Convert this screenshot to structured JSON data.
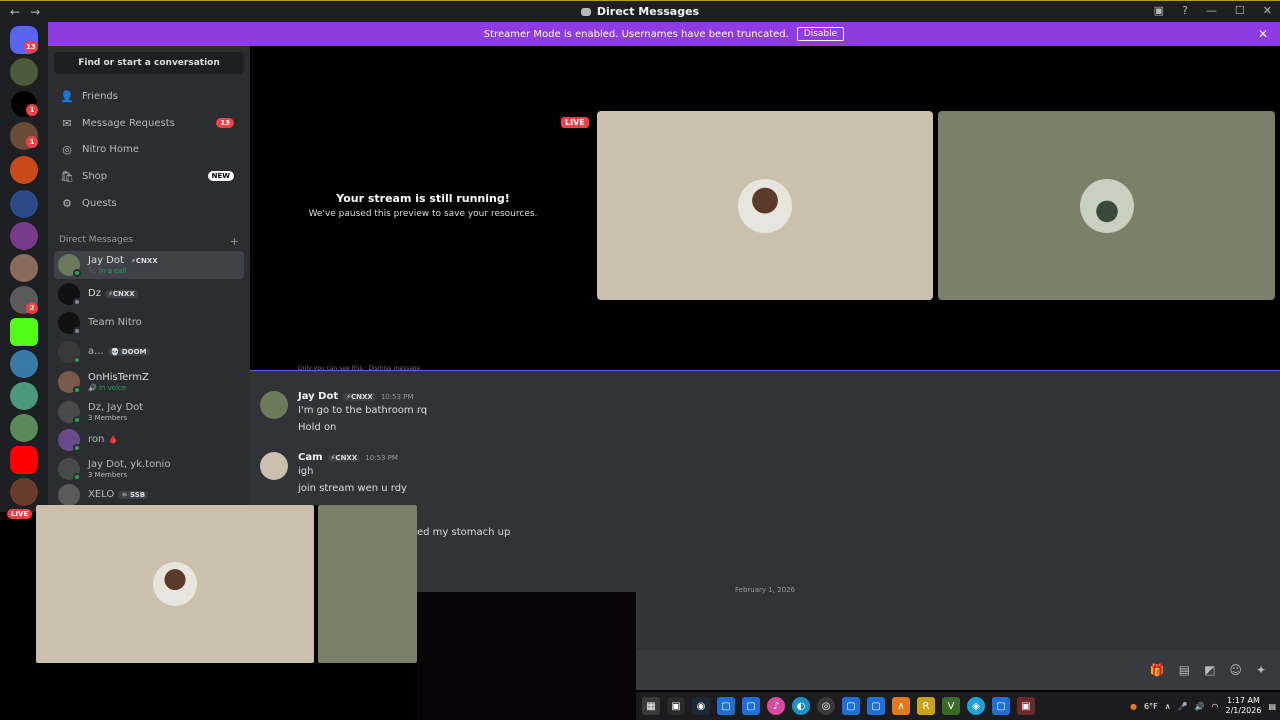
{
  "window": {
    "title": "Direct Messages",
    "nav_back": "←",
    "nav_forward": "→"
  },
  "rail": {
    "home_badge": "13",
    "badge_one": "1",
    "badge_two": "1",
    "badge_three": "2",
    "live": "LIVE"
  },
  "banner": {
    "text": "Streamer Mode is enabled. Usernames have been truncated.",
    "disable_label": "Disable",
    "close": "✕"
  },
  "sidebar": {
    "find_label": "Find or start a conversation",
    "nav": [
      {
        "label": "Friends",
        "icon": "👤"
      },
      {
        "label": "Message Requests",
        "icon": "✉",
        "badge": "13"
      },
      {
        "label": "Nitro Home",
        "icon": "◎"
      },
      {
        "label": "Shop",
        "icon": "🛍",
        "badge": "NEW"
      },
      {
        "label": "Quests",
        "icon": "⚙"
      }
    ],
    "dm_header": "Direct Messages",
    "add": "+",
    "dms": [
      {
        "name": "Jay Dot",
        "tag": "⚡CNXX",
        "sub": "📞 In a call"
      },
      {
        "name": "Dz",
        "tag": "⚡CNXX",
        "sub": ""
      },
      {
        "name": "Team Nitro",
        "tag": "",
        "sub": ""
      },
      {
        "name": "a...",
        "tag": "💀 DOOM",
        "sub": ""
      },
      {
        "name": "OnHisTermZ",
        "tag": "",
        "sub": "🔊 In voice"
      },
      {
        "name": "Dz, Jay Dot",
        "tag": "",
        "sub": "3 Members"
      },
      {
        "name": "ron",
        "tag": "🩸",
        "sub": ""
      },
      {
        "name": "Jay Dot, yk.tonio",
        "tag": "",
        "sub": "3 Members"
      },
      {
        "name": "XELO",
        "tag": "⚛ SSB",
        "sub": ""
      }
    ]
  },
  "stream": {
    "heading": "Your stream is still running!",
    "subtext": "We've paused this preview to save your resources.",
    "live": "LIVE"
  },
  "chat": {
    "hidden_notice": "Only you can see this · Dismiss message",
    "messages": [
      {
        "author": "Jay Dot",
        "tag": "⚡CNXX",
        "time": "10:53 PM",
        "lines": [
          "I'm go to the bathroom rq",
          "Hold on"
        ]
      },
      {
        "author": "Cam",
        "tag": "⚡CNXX",
        "time": "10:53 PM",
        "lines": [
          "igh",
          "join stream wen u rdy"
        ]
      }
    ],
    "partial_line": "ed my stomach up",
    "date_divider": "February 1, 2026"
  },
  "composer_icons": [
    "gift-icon",
    "gif-icon",
    "sticker-icon",
    "emoji-icon",
    "apps-icon"
  ],
  "taskbar": {
    "weather": "6°F",
    "time": "1:17 AM",
    "date": "2/1/2026"
  },
  "colors": {
    "banner": "#8e3be2",
    "live": "#f23f43",
    "tile_one": "#cbbfae",
    "tile_two": "#7a806a"
  }
}
